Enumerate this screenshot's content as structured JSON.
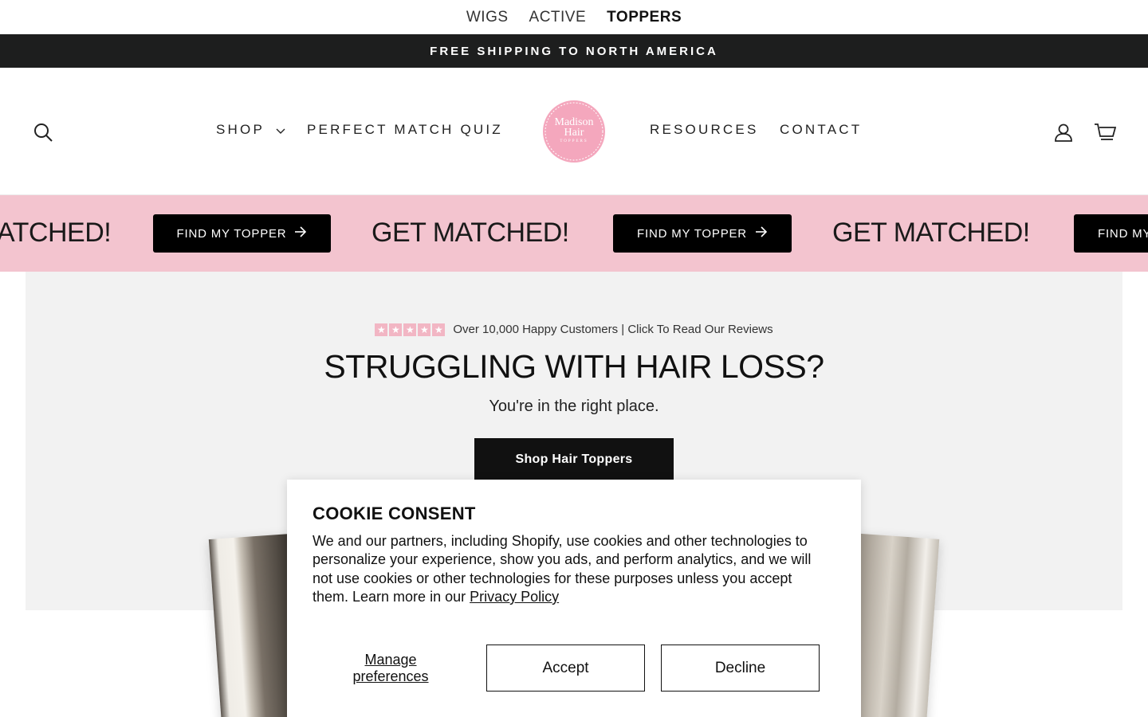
{
  "brand_tabs": [
    {
      "label": "WIGS"
    },
    {
      "label": "ACTIVE"
    },
    {
      "label": "TOPPERS",
      "active": true
    }
  ],
  "announcement": "FREE SHIPPING TO NORTH AMERICA",
  "header": {
    "nav_left": [
      {
        "label": "SHOP",
        "has_dropdown": true
      },
      {
        "label": "PERFECT MATCH QUIZ"
      }
    ],
    "nav_right": [
      {
        "label": "RESOURCES"
      },
      {
        "label": "CONTACT"
      }
    ],
    "logo_lines": [
      "Madison",
      "Hair",
      "TOPPERS"
    ],
    "icons": [
      "search-icon",
      "account-icon",
      "cart-icon"
    ]
  },
  "marquee": {
    "text_partial": "ATCHED!",
    "text": "GET MATCHED!",
    "button_label": "FIND MY TOPPER",
    "button_partial": "FIND MY"
  },
  "hero": {
    "rating_stars": 5,
    "reviews_text": "Over 10,000 Happy Customers | Click To Read Our Reviews",
    "title": "STRUGGLING WITH HAIR LOSS?",
    "subtitle": "You're in the right place.",
    "cta": "Shop Hair Toppers"
  },
  "cookie": {
    "title": "COOKIE CONSENT",
    "body": "We and our partners, including Shopify, use cookies and other technologies to personalize your experience, show you ads, and perform analytics, and we will not use cookies or other technologies for these purposes unless you accept them. Learn more in our ",
    "link": "Privacy Policy",
    "manage": "Manage preferences",
    "accept": "Accept",
    "decline": "Decline"
  },
  "colors": {
    "announcement_bg": "#1d1e1e",
    "marquee_bg": "#f3c4cf",
    "logo_pink": "#f4a7bd",
    "hero_bg": "#f2f2f2"
  }
}
